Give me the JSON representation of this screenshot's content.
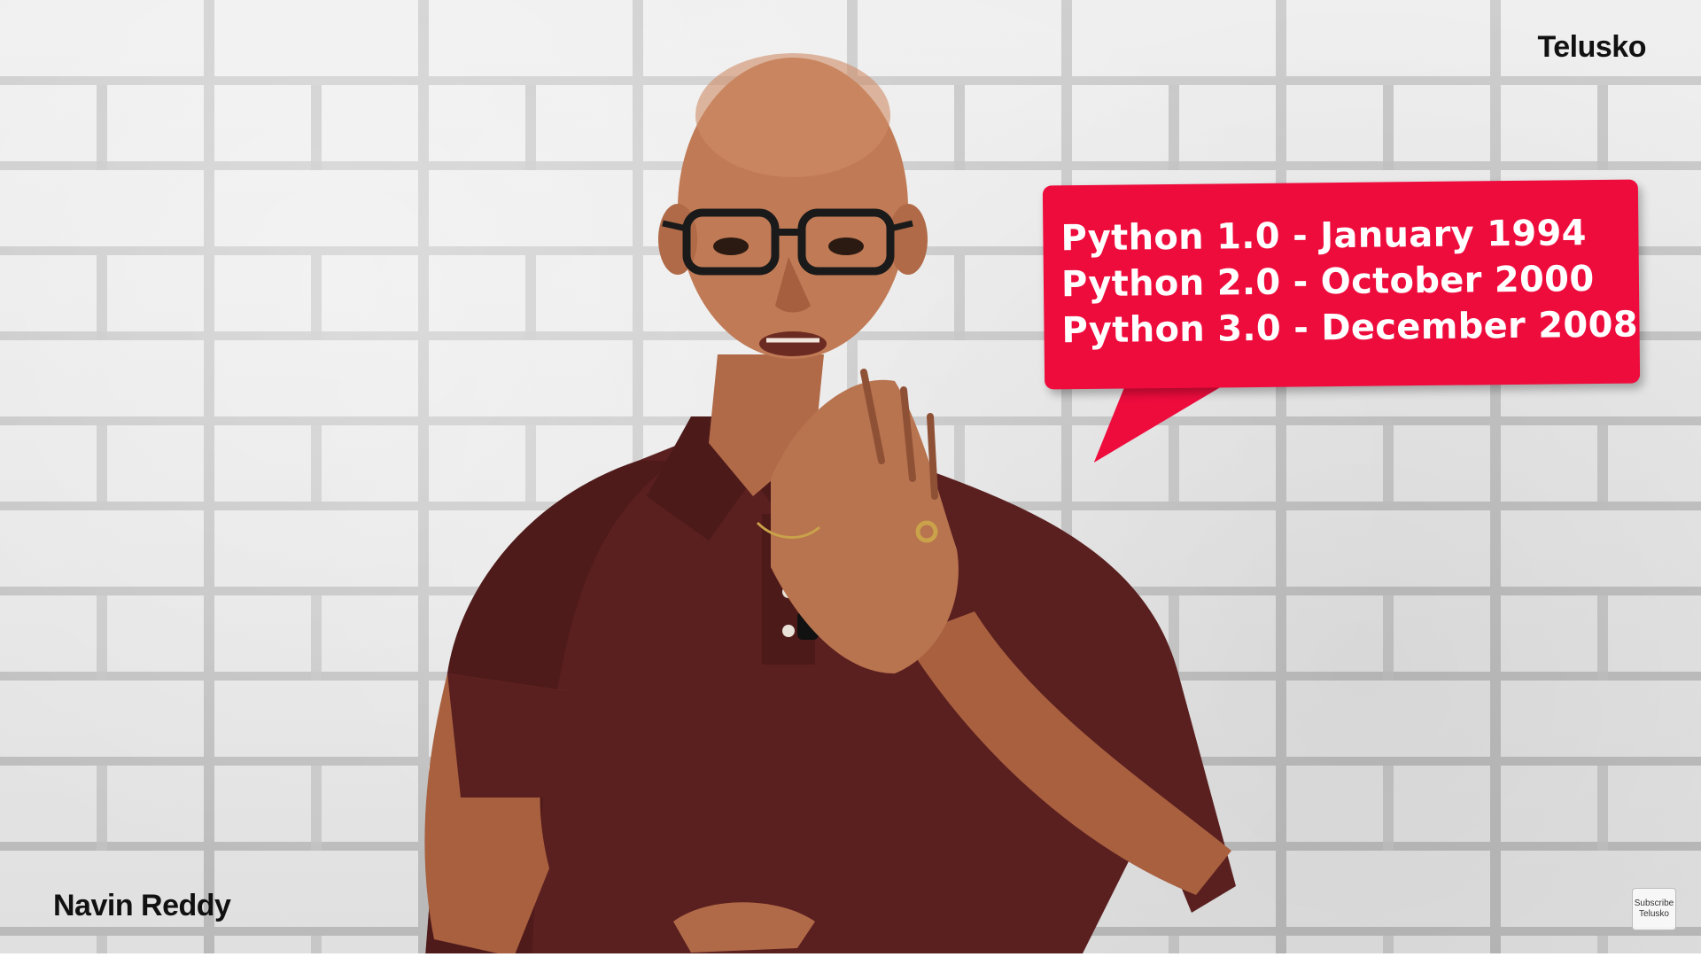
{
  "watermark": {
    "channel": "Telusko",
    "presenter": "Navin Reddy",
    "subscribe": [
      "Subscribe",
      "Telusko"
    ]
  },
  "callout": {
    "lines": [
      "Python 1.0 - January 1994",
      "Python 2.0 - October 2000",
      "Python 3.0 - December 2008"
    ],
    "color": "#ee0c3d"
  },
  "scene": {
    "background": "white brick wall",
    "shirt_color": "#5a1f1f"
  }
}
